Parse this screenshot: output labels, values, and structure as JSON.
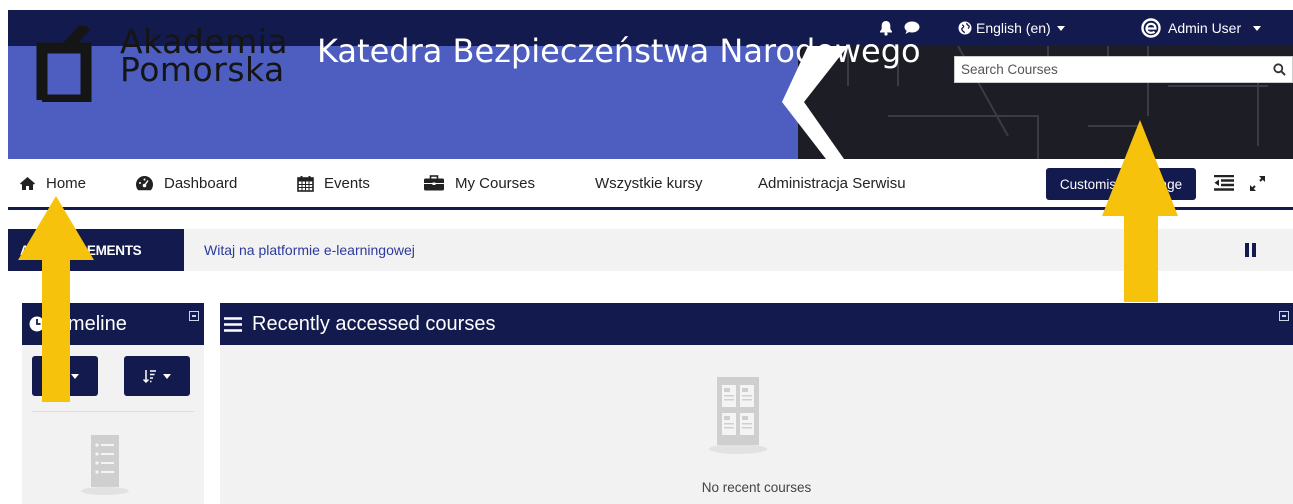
{
  "topbar": {
    "language_label": "English (en)",
    "user_name": "Admin User",
    "icons": [
      "bell-icon",
      "chat-icon",
      "globe-icon",
      "avatar-icon"
    ]
  },
  "banner": {
    "logo_line1": "Akademia",
    "logo_line2": "Pomorska",
    "site_title": "Katedra Bezpieczeństwa Narodowego",
    "search_placeholder": "Search Courses"
  },
  "nav": {
    "items": [
      {
        "label": "Home",
        "icon": "home-icon"
      },
      {
        "label": "Dashboard",
        "icon": "dashboard-icon"
      },
      {
        "label": "Events",
        "icon": "calendar-icon"
      },
      {
        "label": "My Courses",
        "icon": "briefcase-icon"
      },
      {
        "label": "Wszystkie kursy",
        "icon": ""
      },
      {
        "label": "Administracja Serwisu",
        "icon": ""
      }
    ],
    "customise_label": "Customise this page"
  },
  "announcements": {
    "label": "ANNOUNCEMENTS",
    "text": "Witaj na platformie e-learningowej"
  },
  "timeline": {
    "title": "Timeline"
  },
  "recent": {
    "title": "Recently accessed courses",
    "empty_text": "No recent courses"
  },
  "colors": {
    "navy": "#131a4e",
    "banner_blue": "#4d5dc0",
    "link_blue": "#2b3a9c",
    "arrow_yellow": "#f7c20c",
    "panel_gray": "#f2f2f2"
  }
}
